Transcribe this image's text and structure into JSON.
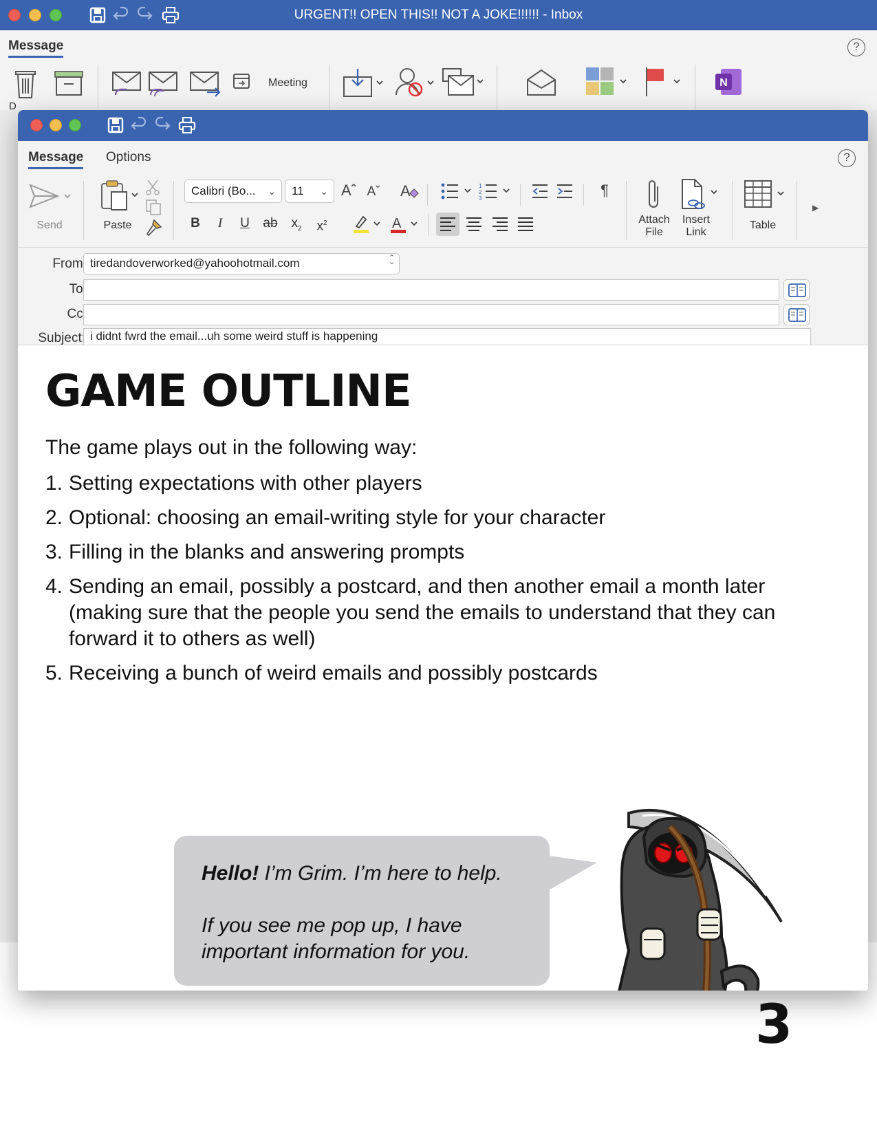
{
  "back_window": {
    "title": "URGENT!! OPEN THIS!! NOT A JOKE!!!!!!  - Inbox",
    "tab": "Message",
    "delete_label": "D",
    "meeting_label": "Meeting"
  },
  "compose": {
    "tabs": [
      "Message",
      "Options"
    ],
    "ribbon": {
      "send": "Send",
      "paste": "Paste",
      "font_name": "Calibri (Bo...",
      "font_size": "11",
      "attach_file": "Attach\nFile",
      "insert_link": "Insert\nLink",
      "table": "Table",
      "attach_file_l1": "Attach",
      "attach_file_l2": "File",
      "insert_link_l1": "Insert",
      "insert_link_l2": "Link"
    },
    "fields": {
      "from_label": "From:",
      "from_value": "tiredandoverworked@yahoohotmail.com",
      "to_label": "To:",
      "to_value": "",
      "cc_label": "Cc:",
      "cc_value": "",
      "subject_label": "Subject:",
      "subject_value": "i didnt fwrd the email...uh some weird stuff is happening"
    },
    "body": {
      "heading": "GAME OUTLINE",
      "intro": "The game plays out in the following way:",
      "steps": [
        {
          "num": "1.",
          "text": "Setting expectations with other players"
        },
        {
          "num": "2.",
          "text": "Optional: choosing an email-writing style for your character"
        },
        {
          "num": "3.",
          "text": "Filling in the blanks and answering prompts"
        },
        {
          "num": "4.",
          "text": "Sending an email, possibly a postcard, and then another email a month later (making sure that the people you send the emails to understand that they can forward it to others as well)"
        },
        {
          "num": "5.",
          "text": "Receiving a bunch of weird emails and possibly postcards"
        }
      ],
      "bubble": {
        "hello": "Hello!",
        "line1_rest": " I’m Grim. I’m here to help.",
        "line2": "If you see me pop up, I have important information for you."
      }
    }
  },
  "page_number": "3",
  "colors": {
    "titlebar": "#3a64b0",
    "chrome": "#f3f3f3",
    "bubble": "#cfcfd2",
    "grim_eyes": "#e0161b"
  },
  "icons": [
    "save-icon",
    "undo-icon",
    "redo-icon",
    "print-icon",
    "help-icon",
    "send-icon",
    "paste-icon",
    "attach-icon",
    "link-icon",
    "table-icon",
    "address-book-icon"
  ]
}
